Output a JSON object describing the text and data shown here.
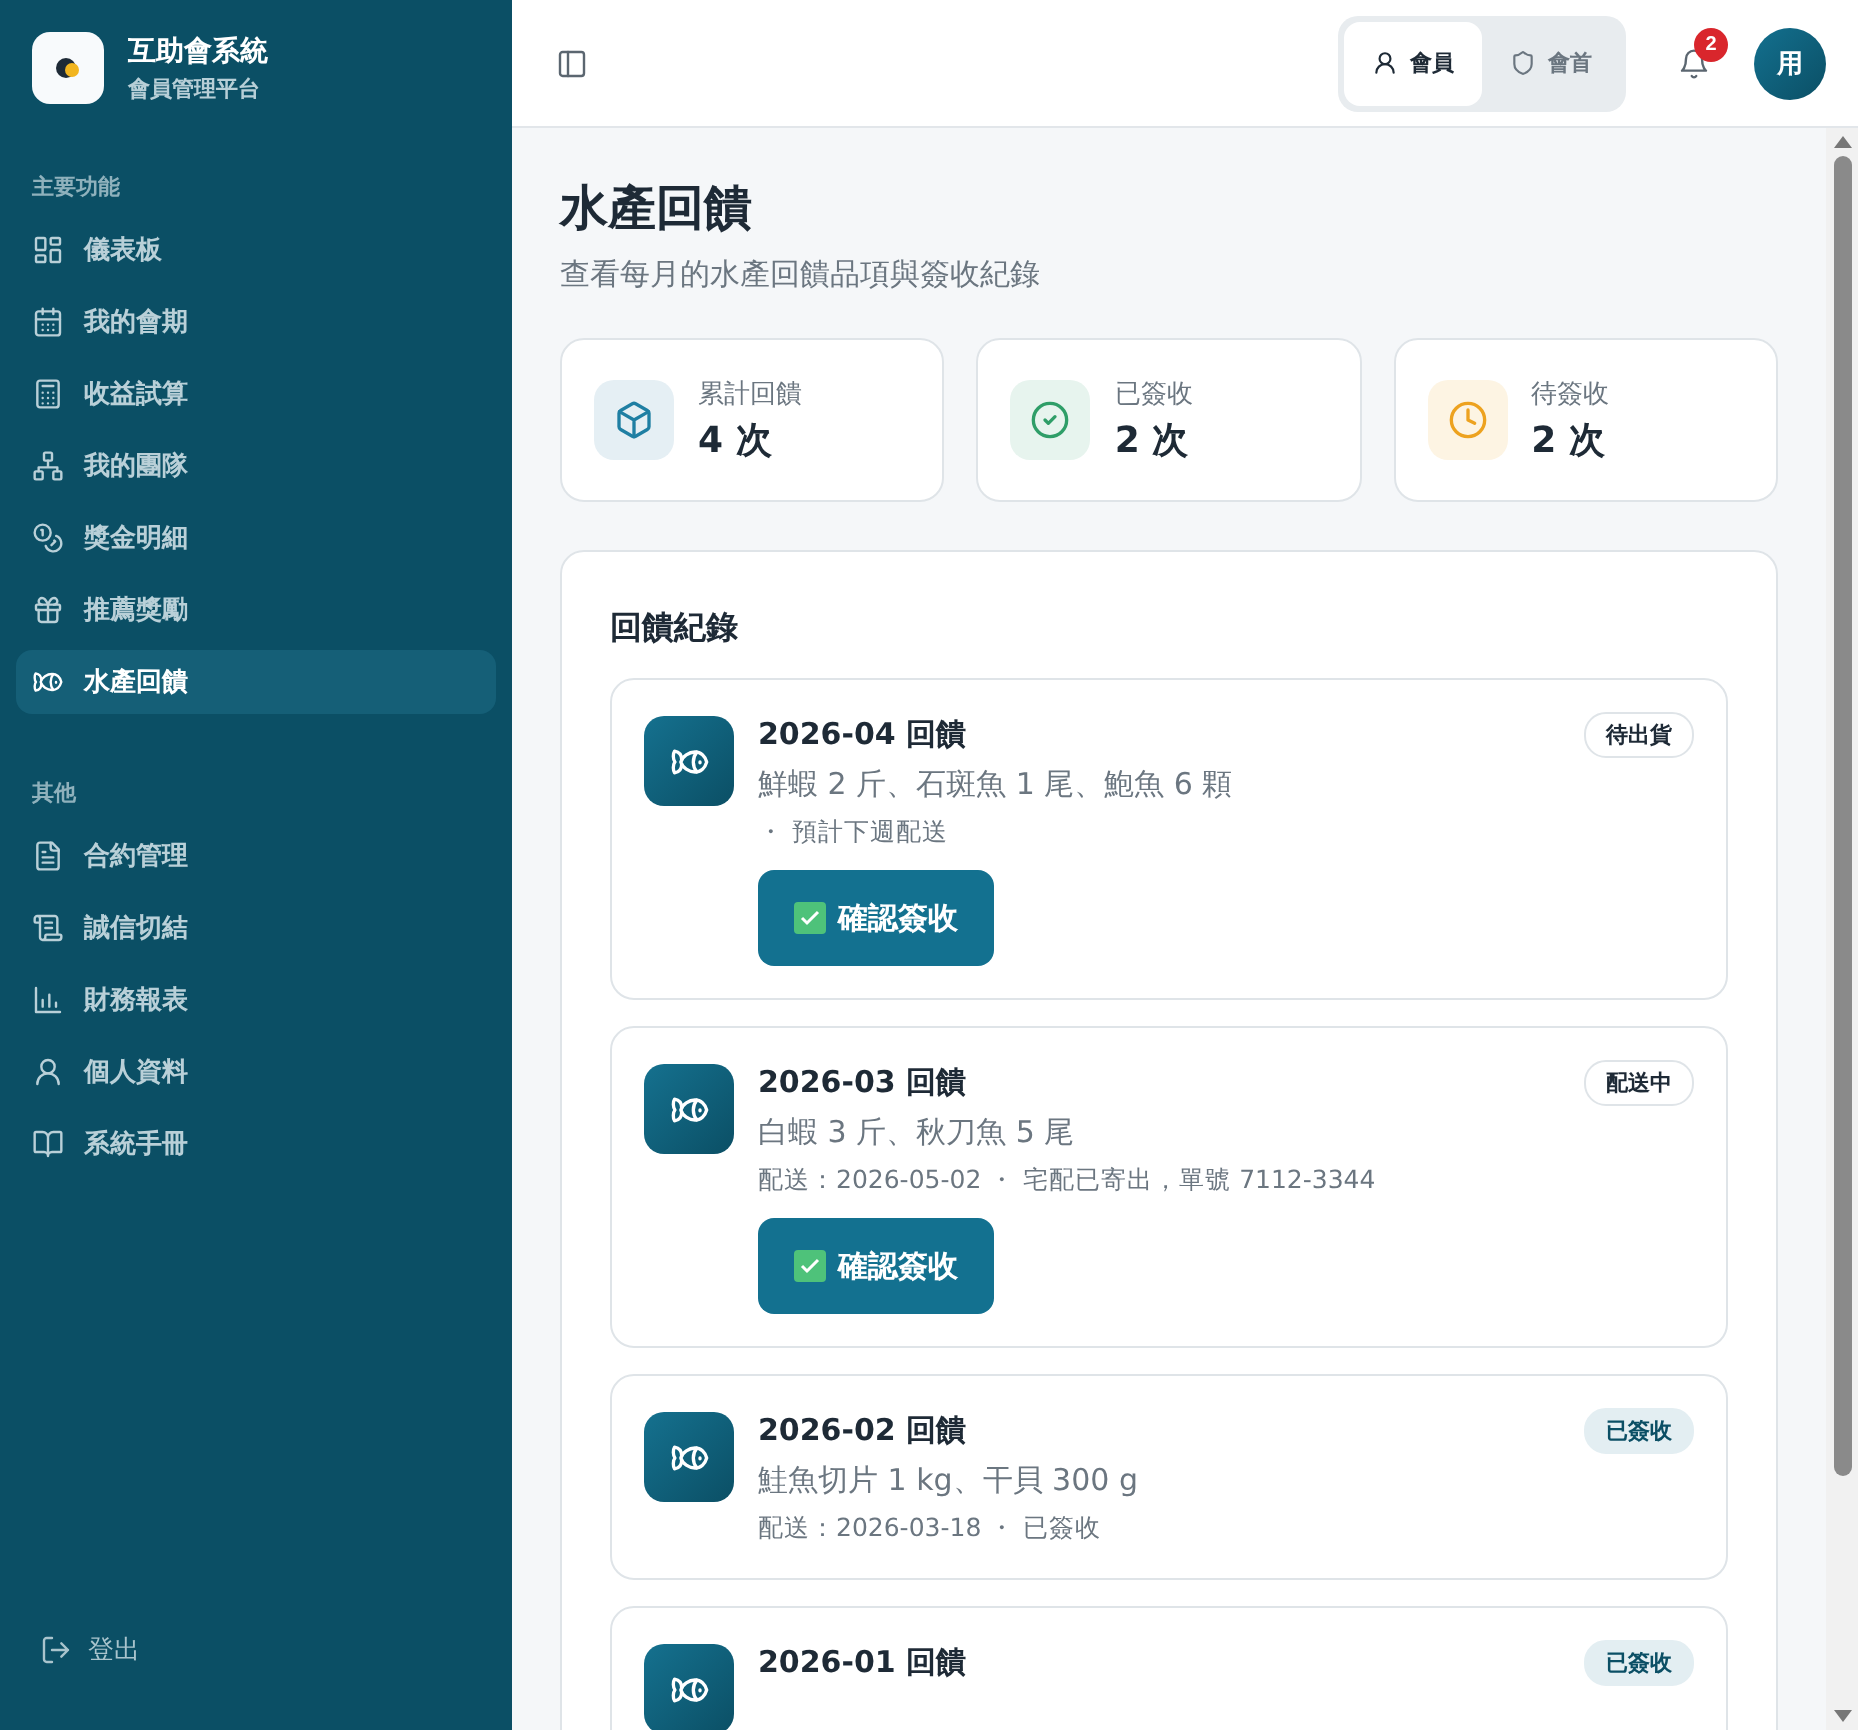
{
  "brand": {
    "title": "互助會系統",
    "subtitle": "會員管理平台"
  },
  "sidebar": {
    "sections": [
      {
        "label": "主要功能",
        "items": [
          {
            "label": "儀表板",
            "selected": false
          },
          {
            "label": "我的會期",
            "selected": false
          },
          {
            "label": "收益試算",
            "selected": false
          },
          {
            "label": "我的團隊",
            "selected": false
          },
          {
            "label": "獎金明細",
            "selected": false
          },
          {
            "label": "推薦獎勵",
            "selected": false
          },
          {
            "label": "水產回饋",
            "selected": true
          }
        ]
      },
      {
        "label": "其他",
        "items": [
          {
            "label": "合約管理",
            "selected": false
          },
          {
            "label": "誠信切結",
            "selected": false
          },
          {
            "label": "財務報表",
            "selected": false
          },
          {
            "label": "個人資料",
            "selected": false
          },
          {
            "label": "系統手冊",
            "selected": false
          }
        ]
      }
    ],
    "logout": "登出"
  },
  "header": {
    "roles": [
      {
        "label": "會員",
        "selected": true
      },
      {
        "label": "會首",
        "selected": false
      }
    ],
    "notification_count": "2",
    "avatar": "用"
  },
  "page": {
    "title": "水產回饋",
    "subtitle": "查看每月的水產回饋品項與簽收紀錄"
  },
  "stats": [
    {
      "kind": "total",
      "label": "累計回饋",
      "value": "4 次"
    },
    {
      "kind": "done",
      "label": "已簽收",
      "value": "2 次"
    },
    {
      "kind": "pending",
      "label": "待簽收",
      "value": "2 次"
    }
  ],
  "records": {
    "title": "回饋紀錄",
    "items": [
      {
        "title": "2026-04 回饋",
        "kind": "pending",
        "badge": "待出貨",
        "items": "鮮蝦 2 斤、石斑魚 1 尾、鮑魚 6 顆",
        "detail": "・ 預計下週配送",
        "button": "確認簽收"
      },
      {
        "title": "2026-03 回饋",
        "kind": "shipping",
        "badge": "配送中",
        "items": "白蝦 3 斤、秋刀魚 5 尾",
        "detail": "配送：2026-05-02 ・ 宅配已寄出，單號 7112-3344",
        "button": "確認簽收"
      },
      {
        "title": "2026-02 回饋",
        "kind": "received",
        "badge": "已簽收",
        "items": "鮭魚切片 1 kg、干貝 300 g",
        "detail": "配送：2026-03-18 ・ 已簽收"
      },
      {
        "title": "2026-01 回饋",
        "kind": "received",
        "badge": "已簽收"
      }
    ]
  }
}
